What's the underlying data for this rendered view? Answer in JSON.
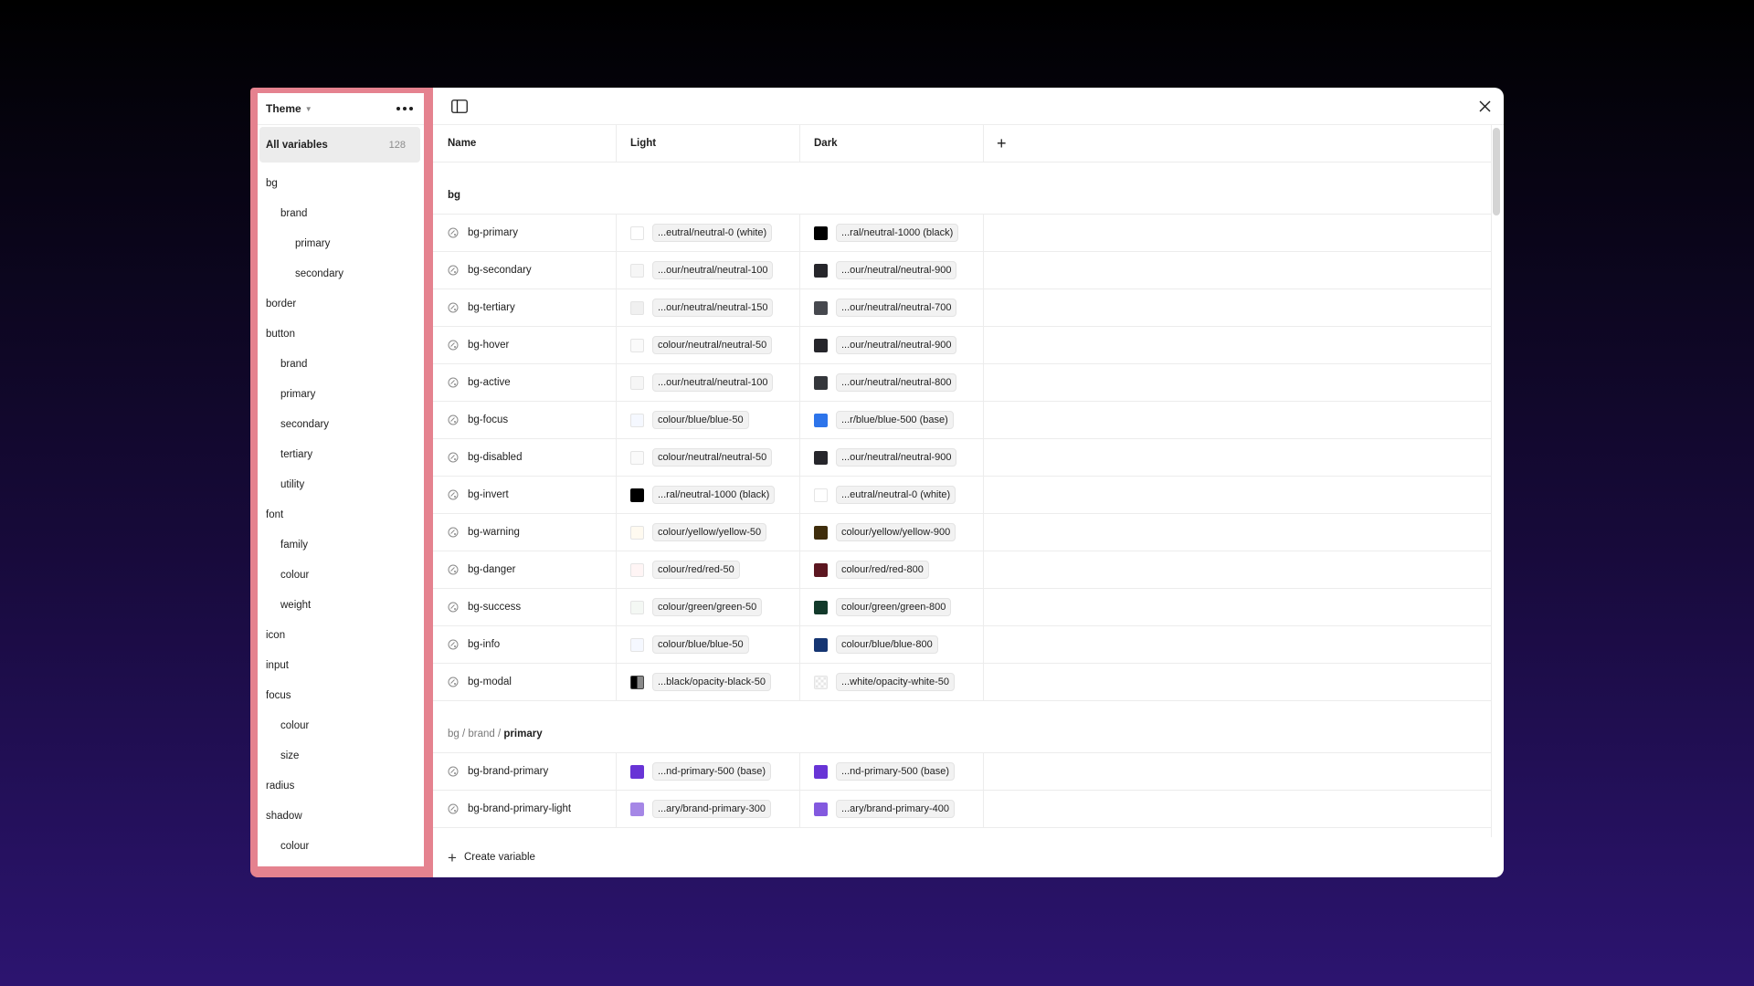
{
  "sidebar": {
    "title": "Theme",
    "all_label": "All variables",
    "all_count": "128",
    "items": [
      {
        "label": "bg",
        "level": 0
      },
      {
        "label": "brand",
        "level": 1
      },
      {
        "label": "primary",
        "level": 2
      },
      {
        "label": "secondary",
        "level": 2
      },
      {
        "label": "border",
        "level": 0
      },
      {
        "label": "button",
        "level": 0
      },
      {
        "label": "brand",
        "level": 1
      },
      {
        "label": "primary",
        "level": 1
      },
      {
        "label": "secondary",
        "level": 1
      },
      {
        "label": "tertiary",
        "level": 1
      },
      {
        "label": "utility",
        "level": 1
      },
      {
        "label": "font",
        "level": 0
      },
      {
        "label": "family",
        "level": 1
      },
      {
        "label": "colour",
        "level": 1
      },
      {
        "label": "weight",
        "level": 1
      },
      {
        "label": "icon",
        "level": 0
      },
      {
        "label": "input",
        "level": 0
      },
      {
        "label": "focus",
        "level": 0
      },
      {
        "label": "colour",
        "level": 1
      },
      {
        "label": "size",
        "level": 1
      },
      {
        "label": "radius",
        "level": 0
      },
      {
        "label": "shadow",
        "level": 0
      },
      {
        "label": "colour",
        "level": 1
      }
    ]
  },
  "table": {
    "headers": {
      "name": "Name",
      "light": "Light",
      "dark": "Dark"
    },
    "groups": [
      {
        "crumbs": [],
        "title": "bg",
        "rows": [
          {
            "name": "bg-primary",
            "light": {
              "swatch": "#ffffff",
              "value": "...eutral/neutral-0 (white)"
            },
            "dark": {
              "swatch": "#000000",
              "value": "...ral/neutral-1000 (black)"
            }
          },
          {
            "name": "bg-secondary",
            "light": {
              "swatch": "#f6f6f6",
              "value": "...our/neutral/neutral-100"
            },
            "dark": {
              "swatch": "#26262b",
              "value": "...our/neutral/neutral-900"
            }
          },
          {
            "name": "bg-tertiary",
            "light": {
              "swatch": "#f0f0f0",
              "value": "...our/neutral/neutral-150"
            },
            "dark": {
              "swatch": "#46484e",
              "value": "...our/neutral/neutral-700"
            }
          },
          {
            "name": "bg-hover",
            "light": {
              "swatch": "#fafafa",
              "value": "colour/neutral/neutral-50"
            },
            "dark": {
              "swatch": "#26262b",
              "value": "...our/neutral/neutral-900"
            }
          },
          {
            "name": "bg-active",
            "light": {
              "swatch": "#f6f6f6",
              "value": "...our/neutral/neutral-100"
            },
            "dark": {
              "swatch": "#34363b",
              "value": "...our/neutral/neutral-800"
            }
          },
          {
            "name": "bg-focus",
            "light": {
              "swatch": "#f5f8ff",
              "value": "colour/blue/blue-50"
            },
            "dark": {
              "swatch": "#2d74ea",
              "value": "...r/blue/blue-500 (base)"
            }
          },
          {
            "name": "bg-disabled",
            "light": {
              "swatch": "#fafafa",
              "value": "colour/neutral/neutral-50"
            },
            "dark": {
              "swatch": "#26262b",
              "value": "...our/neutral/neutral-900"
            }
          },
          {
            "name": "bg-invert",
            "light": {
              "swatch": "#000000",
              "value": "...ral/neutral-1000 (black)"
            },
            "dark": {
              "swatch": "#ffffff",
              "value": "...eutral/neutral-0 (white)"
            }
          },
          {
            "name": "bg-warning",
            "light": {
              "swatch": "#fffaf0",
              "value": "colour/yellow/yellow-50"
            },
            "dark": {
              "swatch": "#3f2d0c",
              "value": "colour/yellow/yellow-900"
            }
          },
          {
            "name": "bg-danger",
            "light": {
              "swatch": "#fff5f5",
              "value": "colour/red/red-50"
            },
            "dark": {
              "swatch": "#5c1620",
              "value": "colour/red/red-800"
            }
          },
          {
            "name": "bg-success",
            "light": {
              "swatch": "#f4f8f4",
              "value": "colour/green/green-50"
            },
            "dark": {
              "swatch": "#12392a",
              "value": "colour/green/green-800"
            }
          },
          {
            "name": "bg-info",
            "light": {
              "swatch": "#f5f8ff",
              "value": "colour/blue/blue-50"
            },
            "dark": {
              "swatch": "#153572",
              "value": "colour/blue/blue-800"
            }
          },
          {
            "name": "bg-modal",
            "light": {
              "swatch": "split-black",
              "value": "...black/opacity-black-50"
            },
            "dark": {
              "swatch": "split-white",
              "value": "...white/opacity-white-50"
            }
          }
        ]
      },
      {
        "crumbs": [
          "bg",
          "brand"
        ],
        "title": "primary",
        "rows": [
          {
            "name": "bg-brand-primary",
            "light": {
              "swatch": "#6834d6",
              "value": "...nd-primary-500 (base)"
            },
            "dark": {
              "swatch": "#6834d6",
              "value": "...nd-primary-500 (base)"
            }
          },
          {
            "name": "bg-brand-primary-light",
            "light": {
              "swatch": "#a587e6",
              "value": "...ary/brand-primary-300"
            },
            "dark": {
              "swatch": "#8359df",
              "value": "...ary/brand-primary-400"
            }
          }
        ]
      }
    ]
  },
  "footer": {
    "create_label": "Create variable"
  }
}
